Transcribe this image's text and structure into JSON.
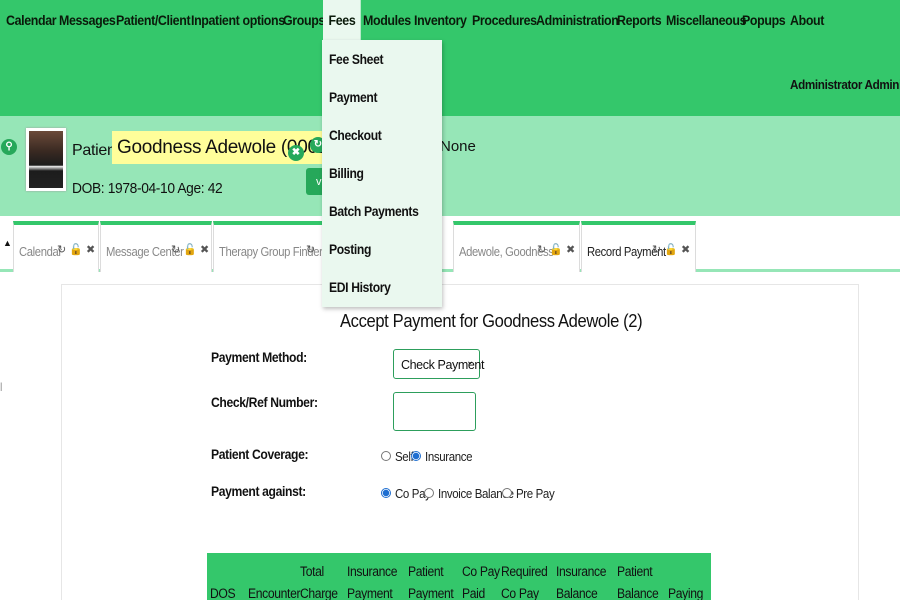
{
  "menu": {
    "items": [
      "Calendar",
      "Messages",
      "Patient/Client",
      "Inpatient options",
      "Groups",
      "Fees",
      "Modules",
      "Inventory",
      "Procedures",
      "Administration",
      "Reports",
      "Miscellaneous",
      "Popups",
      "About"
    ],
    "active": "Fees",
    "user": "Administrator Administr"
  },
  "fees_dropdown": [
    "Fee Sheet",
    "Payment",
    "Checkout",
    "Billing",
    "Batch Payments",
    "Posting",
    "EDI History"
  ],
  "patient": {
    "label": "Patient:",
    "name": "Goodness Adewole (0002)",
    "dob_age": "DOB: 1978-04-10 Age: 42",
    "extra": "None"
  },
  "tabs": [
    {
      "label": "Calendar"
    },
    {
      "label": "Message Center"
    },
    {
      "label": "Therapy Group Finder"
    },
    {
      "label": "Adewole, Goodness"
    },
    {
      "label": "Record Payment"
    }
  ],
  "page": {
    "heading": "Accept Payment for Goodness Adewole (2)",
    "payment_method_label": "Payment Method:",
    "payment_method_value": "Check Payment",
    "check_ref_label": "Check/Ref Number:",
    "check_ref_value": "",
    "coverage_label": "Patient Coverage:",
    "coverage_options": [
      "Self",
      "Insurance"
    ],
    "coverage_selected": "Insurance",
    "against_label": "Payment against:",
    "against_options": [
      "Co Pay",
      "Invoice Balance",
      "Pre Pay"
    ],
    "against_selected": "Co Pay"
  },
  "table": {
    "headers": [
      {
        "l1": "",
        "l2": "DOS"
      },
      {
        "l1": "",
        "l2": "Encounter"
      },
      {
        "l1": "Total",
        "l2": "Charge"
      },
      {
        "l1": "Insurance",
        "l2": "Payment"
      },
      {
        "l1": "Patient",
        "l2": "Payment"
      },
      {
        "l1": "Co Pay",
        "l2": "Paid"
      },
      {
        "l1": "Required",
        "l2": "Co Pay"
      },
      {
        "l1": "Insurance",
        "l2": "Balance"
      },
      {
        "l1": "Patient",
        "l2": "Balance"
      },
      {
        "l1": "",
        "l2": "Paying"
      }
    ]
  },
  "colors": {
    "menu_green": "#34c76b",
    "band_green": "#96e6b7",
    "dropdown_bg": "#eaf8ef",
    "highlight": "#fffe9a"
  }
}
